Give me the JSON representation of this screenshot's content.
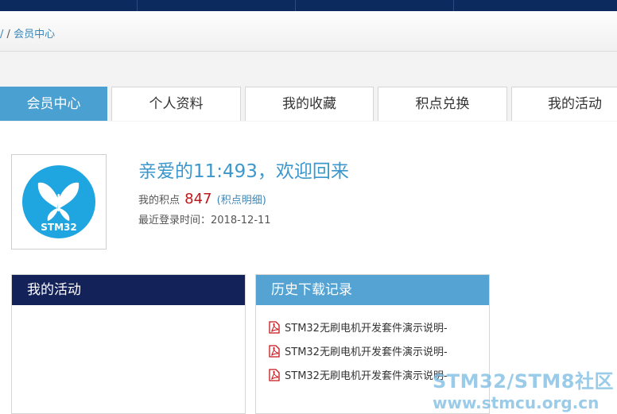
{
  "breadcrumb": {
    "separator": "/",
    "current": "会员中心"
  },
  "tabs": [
    {
      "label": "会员中心",
      "active": true
    },
    {
      "label": "个人资料",
      "active": false
    },
    {
      "label": "我的收藏",
      "active": false
    },
    {
      "label": "积点兑换",
      "active": false
    },
    {
      "label": "我的活动",
      "active": false
    }
  ],
  "profile": {
    "avatar_text": "STM32",
    "welcome": "亲爱的11:493，欢迎回来",
    "points_label": "我的积点",
    "points_value": "847",
    "points_detail_open": "(",
    "points_detail_link": "积点明细",
    "points_detail_close": ")",
    "login_label": "最近登录时间：",
    "login_date": "2018-12-11"
  },
  "panels": {
    "activity": {
      "title": "我的活动"
    },
    "history": {
      "title": "历史下载记录",
      "items": [
        "STM32无刷电机开发套件演示说明-",
        "STM32无刷电机开发套件演示说明-",
        "STM32无刷电机开发套件演示说明-"
      ]
    }
  },
  "watermark": {
    "line1": "STM32/STM8社区",
    "line2": "www.stmcu.org.cn"
  },
  "colors": {
    "nav": "#0d2a5e",
    "active_tab": "#4aa0d0",
    "activity_head": "#14225a",
    "history_head": "#55a3d3",
    "points": "#c0171b",
    "link": "#3a86b8"
  }
}
